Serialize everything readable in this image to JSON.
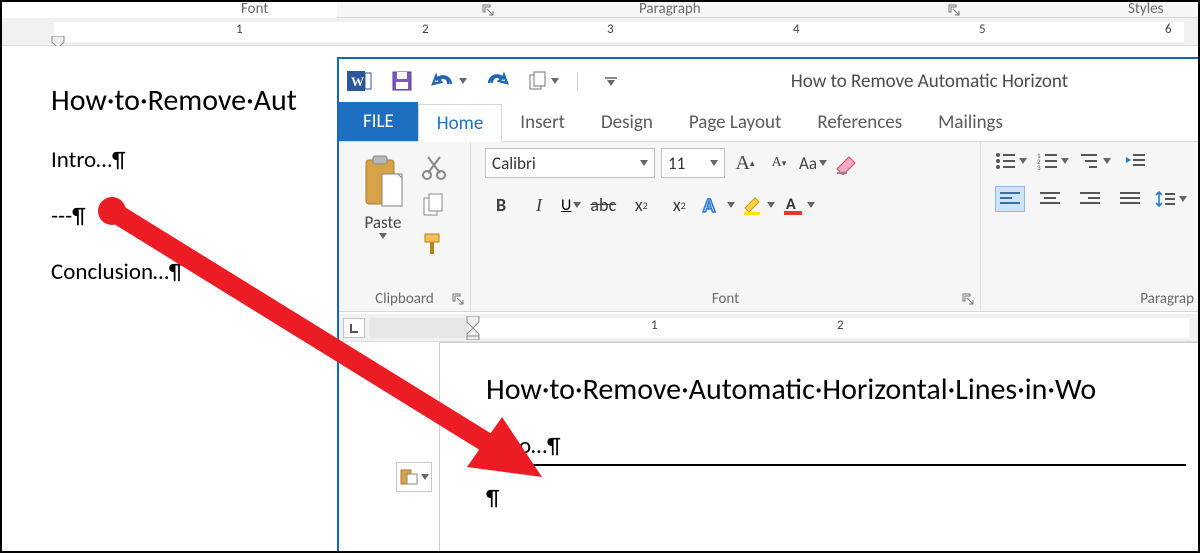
{
  "bg": {
    "group_font": "Font",
    "group_paragraph": "Paragraph",
    "group_styles": "Styles",
    "ruler_numbers": [
      "1",
      "2",
      "3",
      "4",
      "5",
      "6"
    ],
    "doc_title": "How·to·Remove·Aut",
    "line1": "Intro…¶",
    "line2": "---¶",
    "line3": "Conclusion…¶"
  },
  "fg": {
    "window_title": "How to Remove Automatic Horizont",
    "tabs": {
      "file": "FILE",
      "home": "Home",
      "insert": "Insert",
      "design": "Design",
      "page_layout": "Page Layout",
      "references": "References",
      "mailings": "Mailings"
    },
    "clipboard": {
      "paste": "Paste",
      "group": "Clipboard"
    },
    "font": {
      "name": "Calibri",
      "size": "11",
      "group": "Font"
    },
    "paragraph": {
      "group": "Paragrap"
    },
    "ruler_numbers": [
      "1",
      "2"
    ],
    "doc_title": "How·to·Remove·Automatic·Horizontal·Lines·in·Wo",
    "line1": "Intro…¶",
    "line2": "¶"
  }
}
